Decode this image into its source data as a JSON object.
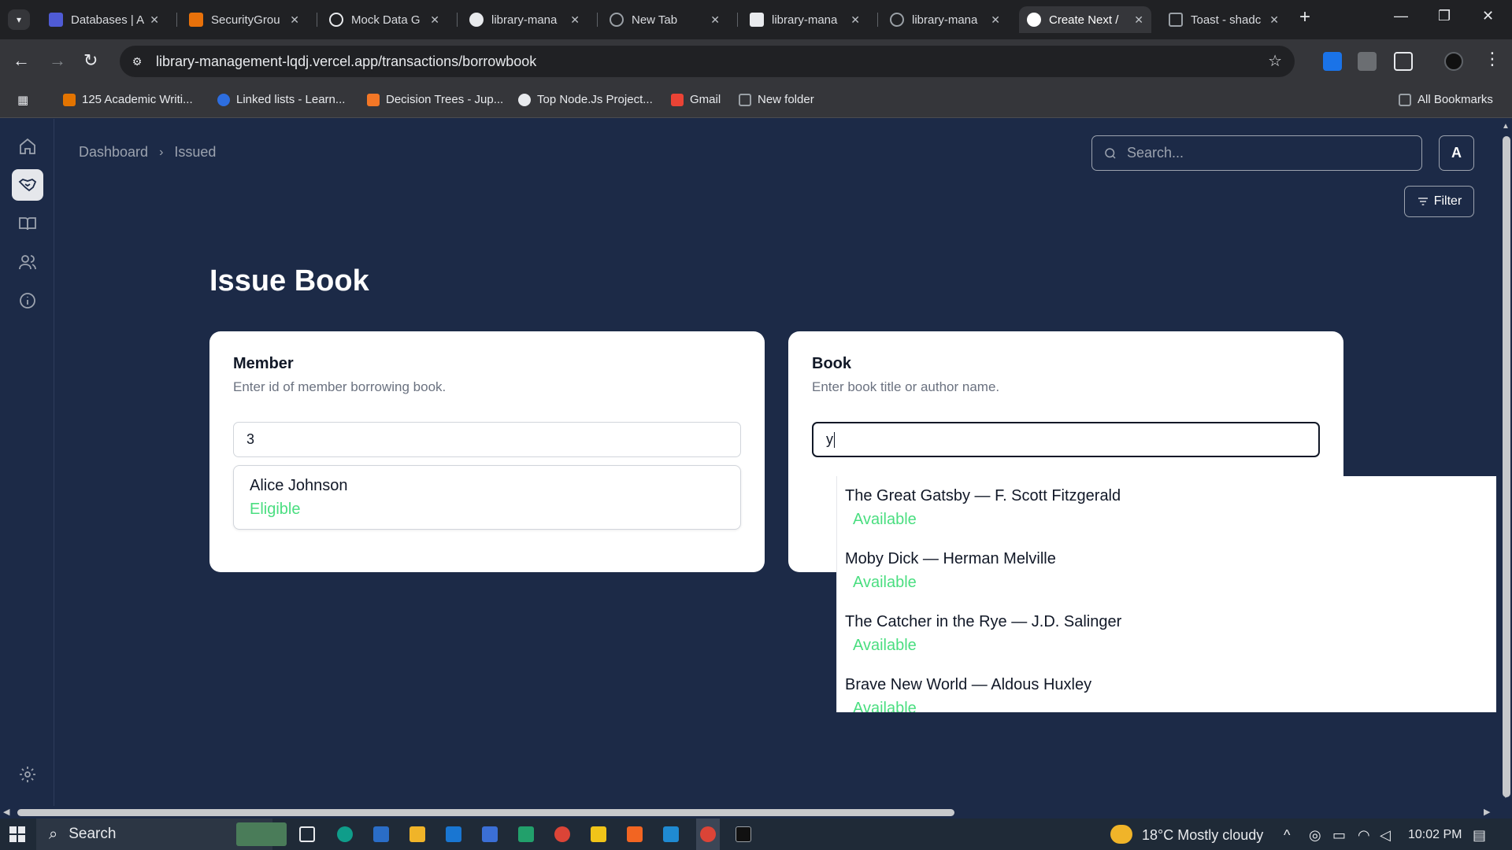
{
  "browser": {
    "tabs": [
      {
        "label": "Databases | A",
        "icon_color": "#4f5bd5"
      },
      {
        "label": "SecurityGrou",
        "icon_color": "#e8710a"
      },
      {
        "label": "Mock Data G",
        "icon_color": "#e8eaed"
      },
      {
        "label": "library-mana",
        "icon_color": "#e8eaed"
      },
      {
        "label": "New Tab",
        "icon_color": "#9aa0a6"
      },
      {
        "label": "library-mana",
        "icon_color": "#e8eaed"
      },
      {
        "label": "library-mana",
        "icon_color": "#9aa0a6"
      },
      {
        "label": "Create Next /",
        "icon_color": "#ffffff"
      },
      {
        "label": "Toast - shadc",
        "icon_color": "#9aa0a6"
      }
    ],
    "new_tab_symbol": "+",
    "url": "library-management-lqdj.vercel.app/transactions/borrowbook",
    "bookmarks": [
      {
        "label": "125 Academic Writi...",
        "icon_color": "#e37400"
      },
      {
        "label": "Linked lists - Learn...",
        "icon_color": "#2d6ee0"
      },
      {
        "label": "Decision Trees - Jup...",
        "icon_color": "#f37726"
      },
      {
        "label": "Top Node.Js Project...",
        "icon_color": "#e8eaed"
      },
      {
        "label": "Gmail",
        "icon_color": "#ea4335"
      },
      {
        "label": "New folder",
        "icon_color": "#9aa0a6"
      }
    ],
    "all_bookmarks": "All Bookmarks"
  },
  "app": {
    "breadcrumb": {
      "root": "Dashboard",
      "current": "Issued"
    },
    "search_placeholder": "Search...",
    "avatar_letter": "A",
    "filter_label": "Filter",
    "page_title": "Issue Book",
    "member_card": {
      "title": "Member",
      "description": "Enter id of member borrowing book.",
      "input_value": "3",
      "result_name": "Alice Johnson",
      "result_status": "Eligible"
    },
    "book_card": {
      "title": "Book",
      "description": "Enter book title or author name.",
      "input_value": "y"
    },
    "book_results": [
      {
        "title": "The Great Gatsby — F. Scott Fitzgerald",
        "status": "Available"
      },
      {
        "title": "Moby Dick — Herman Melville",
        "status": "Available"
      },
      {
        "title": "The Catcher in the Rye — J.D. Salinger",
        "status": "Available"
      },
      {
        "title": "Brave New World — Aldous Huxley",
        "status": "Available"
      }
    ],
    "nav_icons": [
      "home-icon",
      "handshake-icon",
      "book-open-icon",
      "users-icon",
      "info-icon",
      "gear-icon"
    ],
    "colors": {
      "background": "#1c2a47",
      "card": "#ffffff",
      "status_green": "#4ade80"
    }
  },
  "taskbar": {
    "search_label": "Search",
    "weather": "18°C  Mostly cloudy",
    "time": "10:02 PM"
  }
}
